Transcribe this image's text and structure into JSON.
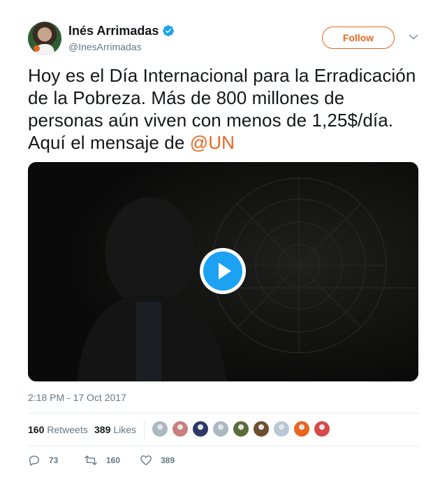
{
  "user": {
    "name": "Inés Arrimadas",
    "handle": "@InesArrimadas",
    "verified": true
  },
  "follow_label": "Follow",
  "tweet": {
    "text": "Hoy es el Día Internacional para la Erradicación de la Pobreza. Más de 800 millones de personas aún viven con menos de 1,25$/día. Aquí el mensaje de ",
    "mention": "@UN"
  },
  "timestamp": "2:18 PM - 17 Oct 2017",
  "stats": {
    "retweets_count": "160",
    "retweets_label": "Retweets",
    "likes_count": "389",
    "likes_label": "Likes"
  },
  "likers": [
    {
      "name": "liker-1",
      "color": "#aab8c2"
    },
    {
      "name": "liker-2",
      "color": "#c97d7d"
    },
    {
      "name": "liker-3",
      "color": "#2b3a67"
    },
    {
      "name": "liker-4",
      "color": "#aab8c2"
    },
    {
      "name": "liker-5",
      "color": "#5a6b3a"
    },
    {
      "name": "liker-6",
      "color": "#6d4e2e"
    },
    {
      "name": "liker-7",
      "color": "#b9c7d6"
    },
    {
      "name": "liker-8",
      "color": "#e8661f"
    },
    {
      "name": "liker-9",
      "color": "#d84a4a"
    }
  ],
  "actions": {
    "reply_count": "73",
    "retweet_count": "160",
    "like_count": "389"
  },
  "colors": {
    "accent": "#e8661f",
    "play": "#1da1f2",
    "muted": "#657786"
  },
  "icons": {
    "verified": "verified-badge-icon",
    "caret": "chevron-down-icon",
    "play": "play-icon",
    "reply": "reply-icon",
    "retweet": "retweet-icon",
    "like": "heart-icon"
  }
}
